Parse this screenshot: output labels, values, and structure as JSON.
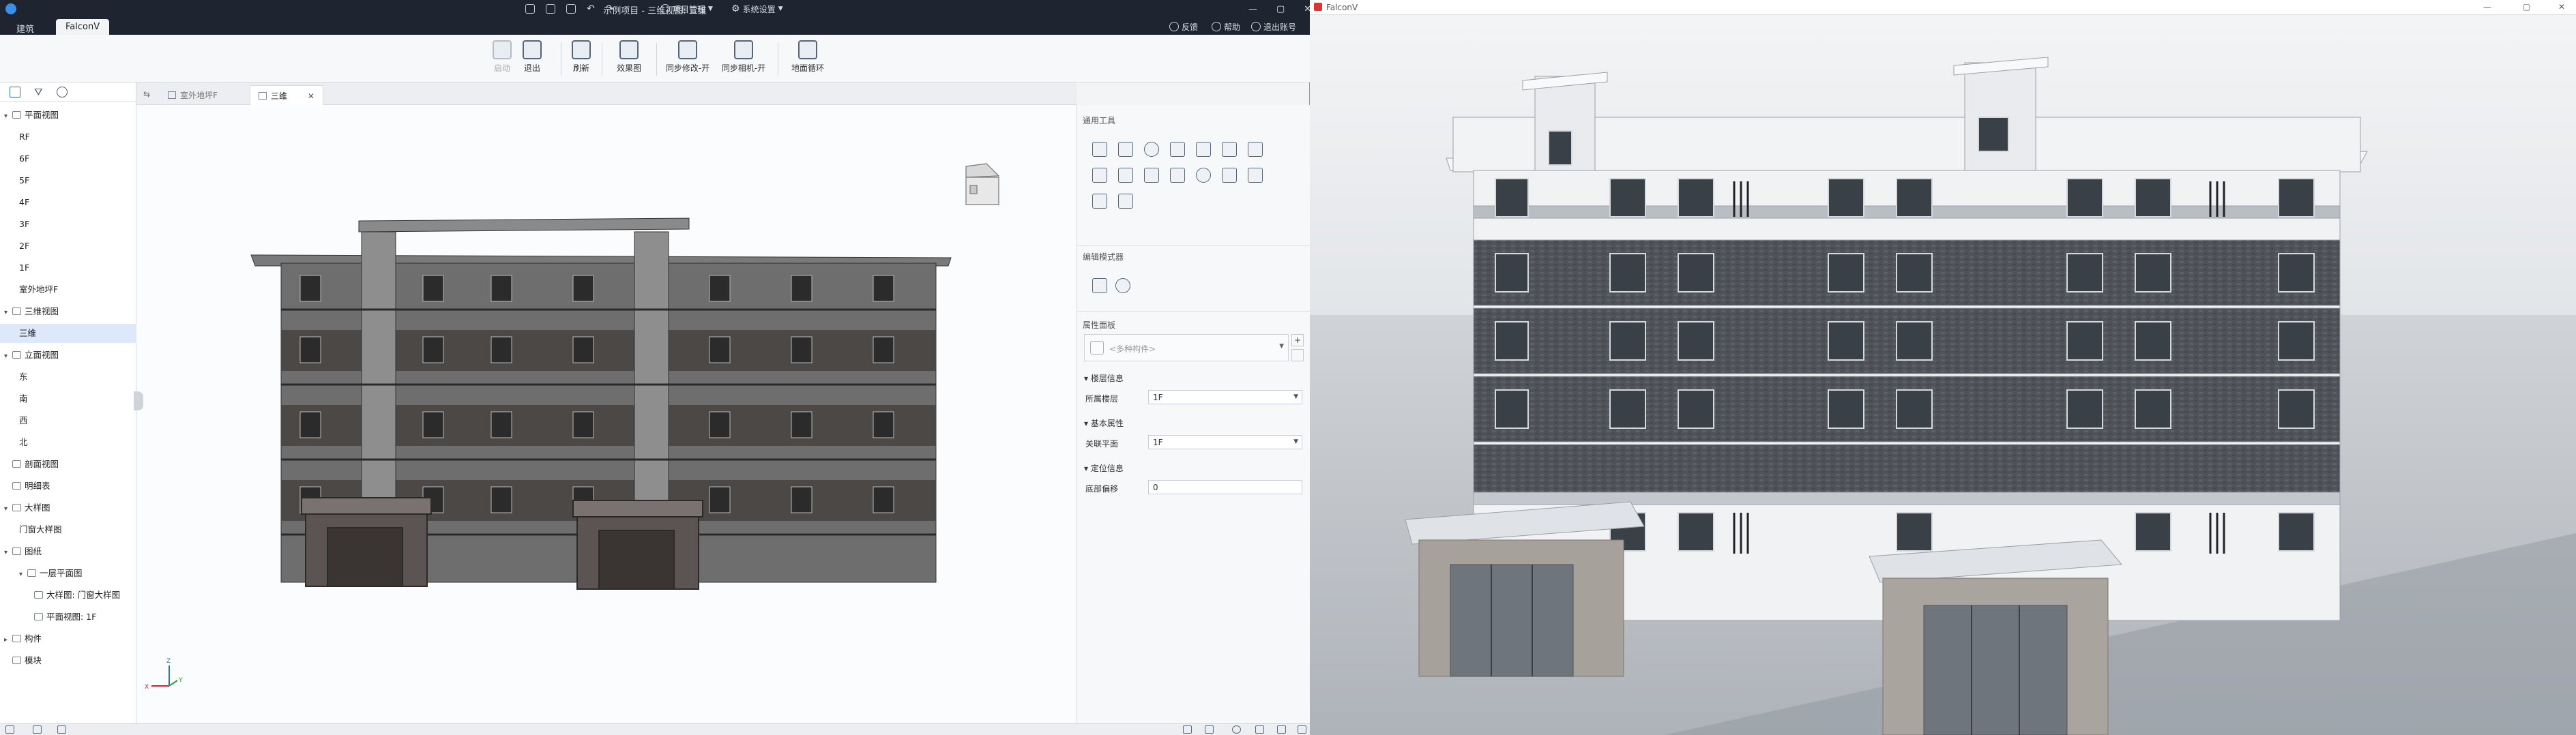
{
  "left_window": {
    "title": "示例项目 - 三维视图: 三维",
    "menu": {
      "project_manage": "项目管理",
      "system_settings": "系统设置",
      "feedback": "反馈",
      "help": "帮助",
      "logout": "退出账号"
    },
    "app_tabs": [
      "建筑",
      "FalconV"
    ],
    "ribbon": [
      {
        "label": "启动",
        "disabled": true
      },
      {
        "label": "退出",
        "disabled": false
      },
      {
        "label": "刷新",
        "disabled": false
      },
      {
        "label": "效果图",
        "disabled": false
      },
      {
        "label": "同步修改-开",
        "disabled": false
      },
      {
        "label": "同步相机-开",
        "disabled": false
      },
      {
        "label": "地面循环",
        "disabled": false
      }
    ],
    "tree": [
      {
        "label": "平面视图",
        "level": 0,
        "expand": "v",
        "icon": true
      },
      {
        "label": "RF",
        "level": 1
      },
      {
        "label": "6F",
        "level": 1
      },
      {
        "label": "5F",
        "level": 1
      },
      {
        "label": "4F",
        "level": 1
      },
      {
        "label": "3F",
        "level": 1
      },
      {
        "label": "2F",
        "level": 1
      },
      {
        "label": "1F",
        "level": 1
      },
      {
        "label": "室外地坪F",
        "level": 1
      },
      {
        "label": "三维视图",
        "level": 0,
        "expand": "v",
        "icon": true
      },
      {
        "label": "三维",
        "level": 1,
        "selected": true
      },
      {
        "label": "立面视图",
        "level": 0,
        "expand": "v",
        "icon": true
      },
      {
        "label": "东",
        "level": 1
      },
      {
        "label": "南",
        "level": 1
      },
      {
        "label": "西",
        "level": 1
      },
      {
        "label": "北",
        "level": 1
      },
      {
        "label": "剖面视图",
        "level": 0,
        "expand": "",
        "icon": true
      },
      {
        "label": "明细表",
        "level": 0,
        "expand": "",
        "icon": true
      },
      {
        "label": "大样图",
        "level": 0,
        "expand": "v",
        "icon": true
      },
      {
        "label": "门窗大样图",
        "level": 1
      },
      {
        "label": "图纸",
        "level": 0,
        "expand": "v",
        "icon": true
      },
      {
        "label": "一层平面图",
        "level": 1,
        "expand": "v",
        "icon": true
      },
      {
        "label": "大样图: 门窗大样图",
        "level": 2,
        "icon": true
      },
      {
        "label": "平面视图: 1F",
        "level": 2,
        "icon": true
      },
      {
        "label": "构件",
        "level": 0,
        "expand": ">",
        "icon": true
      },
      {
        "label": "模块",
        "level": 0,
        "expand": "",
        "icon": true
      }
    ],
    "doc_tabs": [
      {
        "label": "室外地坪F",
        "active": false
      },
      {
        "label": "三维",
        "active": true
      }
    ],
    "props": {
      "common_tools": "通用工具",
      "edit_mode": "编辑模式器",
      "property_panel": "属性面板",
      "placeholder": "<多种构件>",
      "groups": [
        {
          "title": "楼层信息",
          "rows": [
            {
              "label": "所属楼层",
              "value": "1F",
              "dropdown": true
            }
          ]
        },
        {
          "title": "基本属性",
          "rows": [
            {
              "label": "关联平面",
              "value": "1F",
              "dropdown": true
            }
          ]
        },
        {
          "title": "定位信息",
          "rows": [
            {
              "label": "底部偏移",
              "value": "0",
              "dropdown": false
            }
          ]
        }
      ]
    },
    "axes": {
      "x": "X",
      "y": "Y",
      "z": "Z"
    }
  },
  "right_window": {
    "title": "FalconV"
  },
  "colors": {
    "titlebar": "#1e2530",
    "accent": "#2a6fd6",
    "selection": "#dde9fb"
  }
}
